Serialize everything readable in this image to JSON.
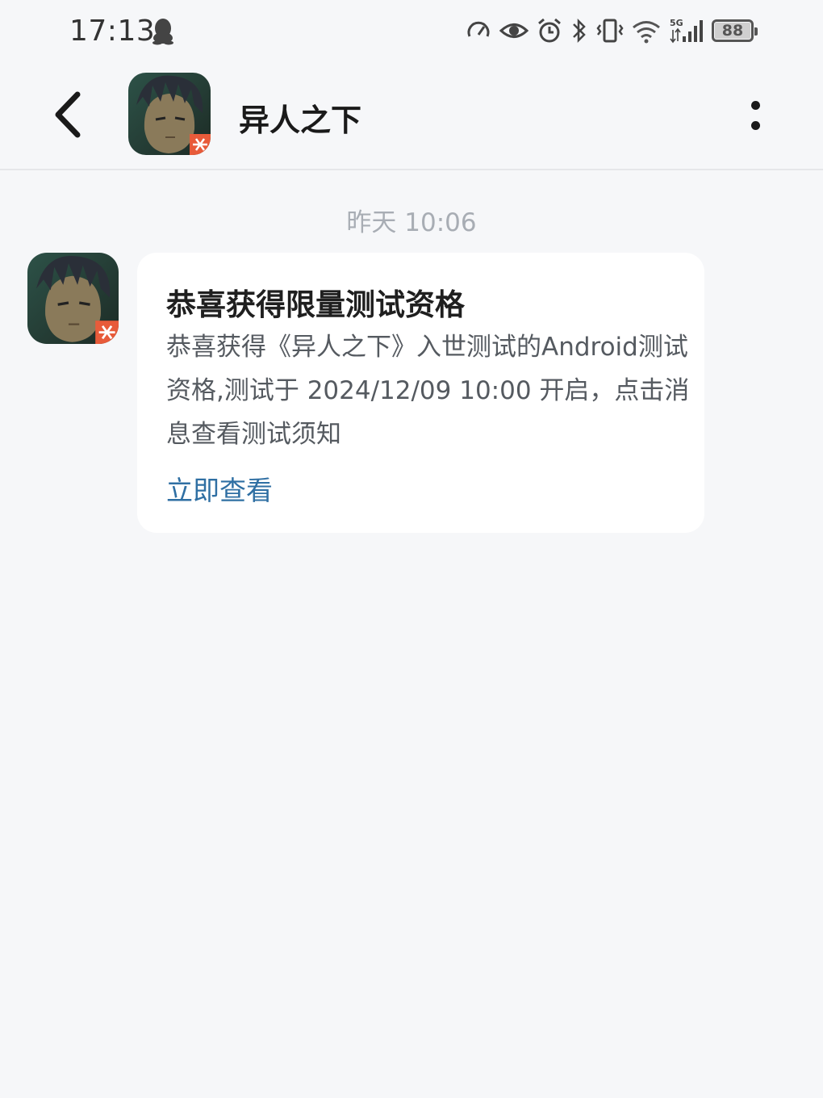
{
  "status_bar": {
    "time": "17:13",
    "battery": "88",
    "icons": [
      "qq-icon",
      "speed-icon",
      "eye-icon",
      "alarm-icon",
      "bluetooth-icon",
      "vibrate-icon",
      "wifi-icon",
      "signal-5g-icon",
      "battery-icon"
    ]
  },
  "header": {
    "title": "异人之下",
    "back_icon": "back-arrow-icon",
    "more_icon": "more-vertical-icon"
  },
  "conversation": {
    "timestamp": "昨天  10:06",
    "message": {
      "title": "恭喜获得限量测试资格",
      "body": "恭喜获得《异人之下》入世测试的Android测试资格,测试于 2024/12/09 10:00 开启，点击消息查看测试须知",
      "link": "立即查看"
    }
  },
  "colors": {
    "background": "#f6f7f9",
    "card": "#ffffff",
    "link": "#2f6fa3",
    "timestamp": "#a8adb4"
  }
}
